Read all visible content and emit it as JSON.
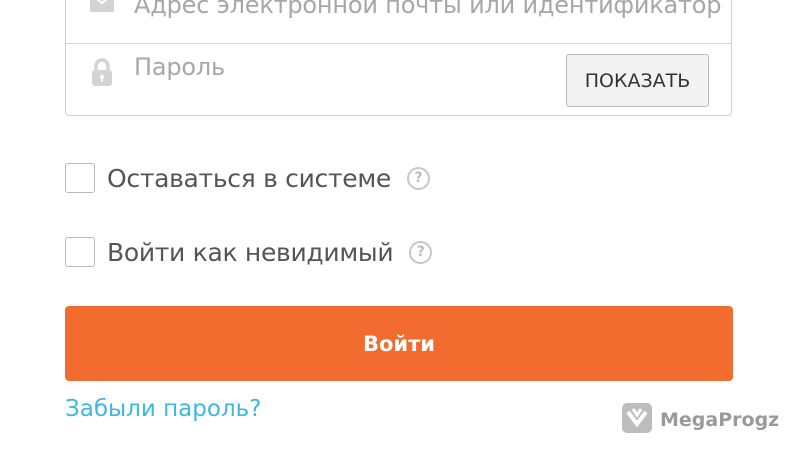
{
  "form": {
    "email_placeholder": "Адрес электронной почты или идентификатор",
    "password_placeholder": "Пароль",
    "show_button": "ПОКАЗАТЬ",
    "stay_signed_in": "Оставаться в системе",
    "invisible_login": "Войти как невидимый",
    "submit": "Войти",
    "forgot_password": "Забыли пароль?"
  },
  "watermark": {
    "text": "MegaProgz"
  },
  "icons": {
    "email": "envelope-icon",
    "password": "lock-icon",
    "help": "question-circle-icon",
    "watermark": "megaprogz-logo"
  },
  "colors": {
    "accent": "#f26c2f",
    "link": "#3db7e4",
    "placeholder": "#a7a7a7",
    "border": "#cfcfcf"
  }
}
